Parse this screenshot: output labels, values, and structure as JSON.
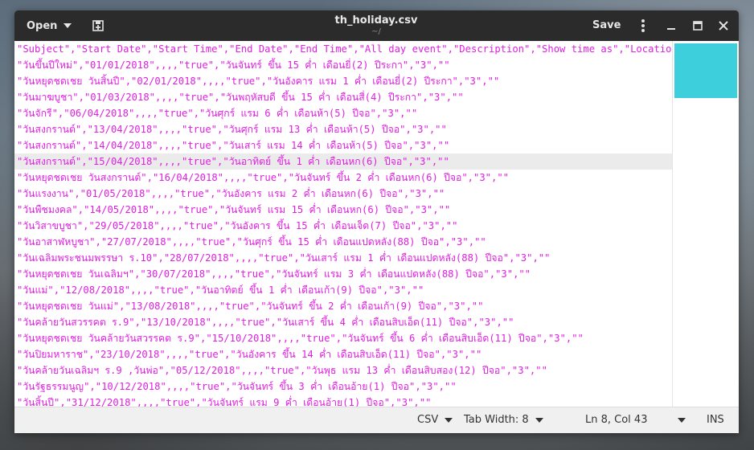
{
  "titlebar": {
    "open_label": "Open",
    "title": "th_holiday.csv",
    "subtitle": "~/",
    "save_label": "Save"
  },
  "editor": {
    "lines": [
      "\"Subject\",\"Start Date\",\"Start Time\",\"End Date\",\"End Time\",\"All day event\",\"Description\",\"Show time as\",\"Location\"",
      "\"วันขึ้นปีใหม่\",\"01/01/2018\",,,,\"true\",\"วันจันทร์ ขึ้น 15 ค่ำ เดือนยี่(2) ปีระกา\",\"3\",\"\"",
      "\"วันหยุดชดเชย วันสิ้นปี\",\"02/01/2018\",,,,\"true\",\"วันอังคาร แรม 1 ค่ำ เดือนยี่(2) ปีระกา\",\"3\",\"\"",
      "\"วันมาฆบูชา\",\"01/03/2018\",,,,\"true\",\"วันพฤหัสบดี ขึ้น 15 ค่ำ เดือนสี่(4) ปีระกา\",\"3\",\"\"",
      "\"วันจักรี\",\"06/04/2018\",,,,\"true\",\"วันศุกร์ แรม 6 ค่ำ เดือนห้า(5) ปีจอ\",\"3\",\"\"",
      "\"วันสงกรานต์\",\"13/04/2018\",,,,\"true\",\"วันศุกร์ แรม 13 ค่ำ เดือนห้า(5) ปีจอ\",\"3\",\"\"",
      "\"วันสงกรานต์\",\"14/04/2018\",,,,\"true\",\"วันเสาร์ แรม 14 ค่ำ เดือนห้า(5) ปีจอ\",\"3\",\"\"",
      "\"วันสงกรานต์\",\"15/04/2018\",,,,\"true\",\"วันอาทิตย์ ขึ้น 1 ค่ำ เดือนหก(6) ปีจอ\",\"3\",\"\"",
      "\"วันหยุดชดเชย วันสงกรานต์\",\"16/04/2018\",,,,\"true\",\"วันจันทร์ ขึ้น 2 ค่ำ เดือนหก(6) ปีจอ\",\"3\",\"\"",
      "\"วันแรงงาน\",\"01/05/2018\",,,,\"true\",\"วันอังคาร แรม 2 ค่ำ เดือนหก(6) ปีจอ\",\"3\",\"\"",
      "\"วันพืชมงคล\",\"14/05/2018\",,,,\"true\",\"วันจันทร์ แรม 15 ค่ำ เดือนหก(6) ปีจอ\",\"3\",\"\"",
      "\"วันวิสาขบูชา\",\"29/05/2018\",,,,\"true\",\"วันอังคาร ขึ้น 15 ค่ำ เดือนเจ็ด(7) ปีจอ\",\"3\",\"\"",
      "\"วันอาสาฬหบูชา\",\"27/07/2018\",,,,\"true\",\"วันศุกร์ ขึ้น 15 ค่ำ เดือนแปดหลัง(88) ปีจอ\",\"3\",\"\"",
      "\"วันเฉลิมพระชนมพรรษา ร.10\",\"28/07/2018\",,,,\"true\",\"วันเสาร์ แรม 1 ค่ำ เดือนแปดหลัง(88) ปีจอ\",\"3\",\"\"",
      "\"วันหยุดชดเชย วันเฉลิมฯ\",\"30/07/2018\",,,,\"true\",\"วันจันทร์ แรม 3 ค่ำ เดือนแปดหลัง(88) ปีจอ\",\"3\",\"\"",
      "\"วันแม่\",\"12/08/2018\",,,,\"true\",\"วันอาทิตย์ ขึ้น 1 ค่ำ เดือนเก้า(9) ปีจอ\",\"3\",\"\"",
      "\"วันหยุดชดเชย วันแม่\",\"13/08/2018\",,,,\"true\",\"วันจันทร์ ขึ้น 2 ค่ำ เดือนเก้า(9) ปีจอ\",\"3\",\"\"",
      "\"วันคล้ายวันสวรรคต ร.9\",\"13/10/2018\",,,,\"true\",\"วันเสาร์ ขึ้น 4 ค่ำ เดือนสิบเอ็ด(11) ปีจอ\",\"3\",\"\"",
      "\"วันหยุดชดเชย วันคล้ายวันสวรรคต ร.9\",\"15/10/2018\",,,,\"true\",\"วันจันทร์ ขึ้น 6 ค่ำ เดือนสิบเอ็ด(11) ปีจอ\",\"3\",\"\"",
      "\"วันปิยมหาราช\",\"23/10/2018\",,,,\"true\",\"วันอังคาร ขึ้น 14 ค่ำ เดือนสิบเอ็ด(11) ปีจอ\",\"3\",\"\"",
      "\"วันคล้ายวันเฉลิมฯ ร.9 ,วันพ่อ\",\"05/12/2018\",,,,\"true\",\"วันพุธ แรม 13 ค่ำ เดือนสิบสอง(12) ปีจอ\",\"3\",\"\"",
      "\"วันรัฐธรรมนูญ\",\"10/12/2018\",,,,\"true\",\"วันจันทร์ ขึ้น 3 ค่ำ เดือนอ้าย(1) ปีจอ\",\"3\",\"\"",
      "\"วันสิ้นปี\",\"31/12/2018\",,,,\"true\",\"วันจันทร์ แรม 9 ค่ำ เดือนอ้าย(1) ปีจอ\",\"3\",\"\""
    ],
    "current_line_index": 7,
    "text_color": "#e020e0",
    "minimap_color": "#3dd0dc"
  },
  "statusbar": {
    "language": "CSV",
    "tab_width": "Tab Width: 8",
    "position": "Ln 8, Col 43",
    "mode": "INS"
  }
}
